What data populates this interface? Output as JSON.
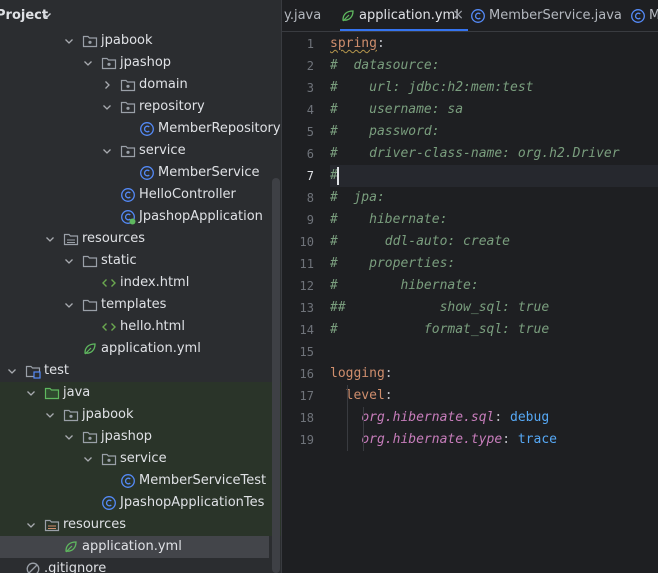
{
  "project_panel": {
    "title": "Project",
    "tree": [
      {
        "label": "jpabook",
        "kind": "package",
        "chevron": "down",
        "indent": 0
      },
      {
        "label": "jpashop",
        "kind": "package",
        "chevron": "down",
        "indent": 1
      },
      {
        "label": "domain",
        "kind": "package",
        "chevron": "right",
        "indent": 2
      },
      {
        "label": "repository",
        "kind": "package",
        "chevron": "down",
        "indent": 2
      },
      {
        "label": "MemberRepository",
        "kind": "class",
        "chevron": "none",
        "indent": 3
      },
      {
        "label": "service",
        "kind": "package",
        "chevron": "down",
        "indent": 2
      },
      {
        "label": "MemberService",
        "kind": "class",
        "chevron": "none",
        "indent": 3
      },
      {
        "label": "HelloController",
        "kind": "class",
        "chevron": "none",
        "indent": 2
      },
      {
        "label": "JpashopApplication",
        "kind": "spring-class",
        "chevron": "none",
        "indent": 2
      },
      {
        "label": "resources",
        "kind": "resources",
        "chevron": "down",
        "indent": -1
      },
      {
        "label": "static",
        "kind": "folder",
        "chevron": "down",
        "indent": 0
      },
      {
        "label": "index.html",
        "kind": "html",
        "chevron": "none",
        "indent": 1
      },
      {
        "label": "templates",
        "kind": "folder",
        "chevron": "down",
        "indent": 0
      },
      {
        "label": "hello.html",
        "kind": "html",
        "chevron": "none",
        "indent": 1
      },
      {
        "label": "application.yml",
        "kind": "yml",
        "chevron": "none",
        "indent": 0
      },
      {
        "label": "test",
        "kind": "module-folder",
        "chevron": "down",
        "indent": -3
      },
      {
        "label": "java",
        "kind": "test-src",
        "chevron": "down",
        "indent": -2
      },
      {
        "label": "jpabook",
        "kind": "package",
        "chevron": "down",
        "indent": -1
      },
      {
        "label": "jpashop",
        "kind": "package",
        "chevron": "down",
        "indent": 0
      },
      {
        "label": "service",
        "kind": "package",
        "chevron": "down",
        "indent": 1
      },
      {
        "label": "MemberServiceTest",
        "kind": "class",
        "chevron": "none",
        "indent": 2
      },
      {
        "label": "JpashopApplicationTes",
        "kind": "class",
        "chevron": "none",
        "indent": 1
      },
      {
        "label": "resources",
        "kind": "test-resources",
        "chevron": "down",
        "indent": -2
      },
      {
        "label": "application.yml",
        "kind": "yml",
        "chevron": "none",
        "indent": -1
      },
      {
        "label": ".gitignore",
        "kind": "ignore",
        "chevron": "none",
        "indent": -3
      }
    ],
    "selected_index": 23
  },
  "editor": {
    "tabs": [
      {
        "label": "y.java",
        "icon": "none",
        "active": false
      },
      {
        "label": "application.yml",
        "icon": "yml-icon",
        "active": true,
        "closable": true
      },
      {
        "label": "MemberService.java",
        "icon": "class-icon",
        "active": false
      },
      {
        "label": "M",
        "icon": "class-icon",
        "active": false
      }
    ],
    "close_glyph": "×",
    "current_line": 7,
    "lines": [
      {
        "n": "1",
        "segs": [
          {
            "t": "spring",
            "c": "key squig"
          },
          {
            "t": ":",
            "c": "pun"
          }
        ]
      },
      {
        "n": "2",
        "segs": [
          {
            "t": "#  datasource:",
            "c": "cm"
          }
        ]
      },
      {
        "n": "3",
        "segs": [
          {
            "t": "#    url: jdbc:h2:mem:test",
            "c": "cm"
          }
        ]
      },
      {
        "n": "4",
        "segs": [
          {
            "t": "#    username: sa",
            "c": "cm"
          }
        ]
      },
      {
        "n": "5",
        "segs": [
          {
            "t": "#    password:",
            "c": "cm"
          }
        ]
      },
      {
        "n": "6",
        "segs": [
          {
            "t": "#    driver-class-name: org.h2.Driver",
            "c": "cm"
          }
        ]
      },
      {
        "n": "7",
        "segs": [
          {
            "t": "#",
            "c": "cm"
          }
        ]
      },
      {
        "n": "8",
        "segs": [
          {
            "t": "#  jpa:",
            "c": "cm"
          }
        ]
      },
      {
        "n": "9",
        "segs": [
          {
            "t": "#    hibernate:",
            "c": "cm"
          }
        ]
      },
      {
        "n": "10",
        "segs": [
          {
            "t": "#      ddl-auto: create",
            "c": "cm"
          }
        ]
      },
      {
        "n": "11",
        "segs": [
          {
            "t": "#    properties:",
            "c": "cm"
          }
        ]
      },
      {
        "n": "12",
        "segs": [
          {
            "t": "#        hibernate:",
            "c": "cm"
          }
        ]
      },
      {
        "n": "13",
        "segs": [
          {
            "t": "##            show_sql: true",
            "c": "cm"
          }
        ]
      },
      {
        "n": "14",
        "segs": [
          {
            "t": "#           format_sql: true",
            "c": "cm"
          }
        ]
      },
      {
        "n": "15",
        "segs": []
      },
      {
        "n": "16",
        "segs": [
          {
            "t": "logging",
            "c": "key"
          },
          {
            "t": ":",
            "c": "pun"
          }
        ]
      },
      {
        "n": "17",
        "segs": [
          {
            "t": "  ",
            "c": "pun"
          },
          {
            "t": "level",
            "c": "key"
          },
          {
            "t": ":",
            "c": "pun"
          }
        ]
      },
      {
        "n": "18",
        "segs": [
          {
            "t": "    ",
            "c": "pun"
          },
          {
            "t": "org.hibernate.sql",
            "c": "kw-it"
          },
          {
            "t": ": ",
            "c": "pun"
          },
          {
            "t": "debug",
            "c": "sval"
          }
        ]
      },
      {
        "n": "19",
        "segs": [
          {
            "t": "    ",
            "c": "pun"
          },
          {
            "t": "org.hibernate.type",
            "c": "kw-it"
          },
          {
            "t": ": ",
            "c": "pun"
          },
          {
            "t": "trace",
            "c": "sval"
          }
        ]
      }
    ]
  },
  "colors": {
    "panel_bg": "#2b2d30",
    "editor_bg": "#1e1f22",
    "folder": "#9aa0a8",
    "class_icon": "#548af7",
    "spring_green": "#5fb85f",
    "html_icon": "#6aa84f",
    "accent": "#3574f0"
  }
}
